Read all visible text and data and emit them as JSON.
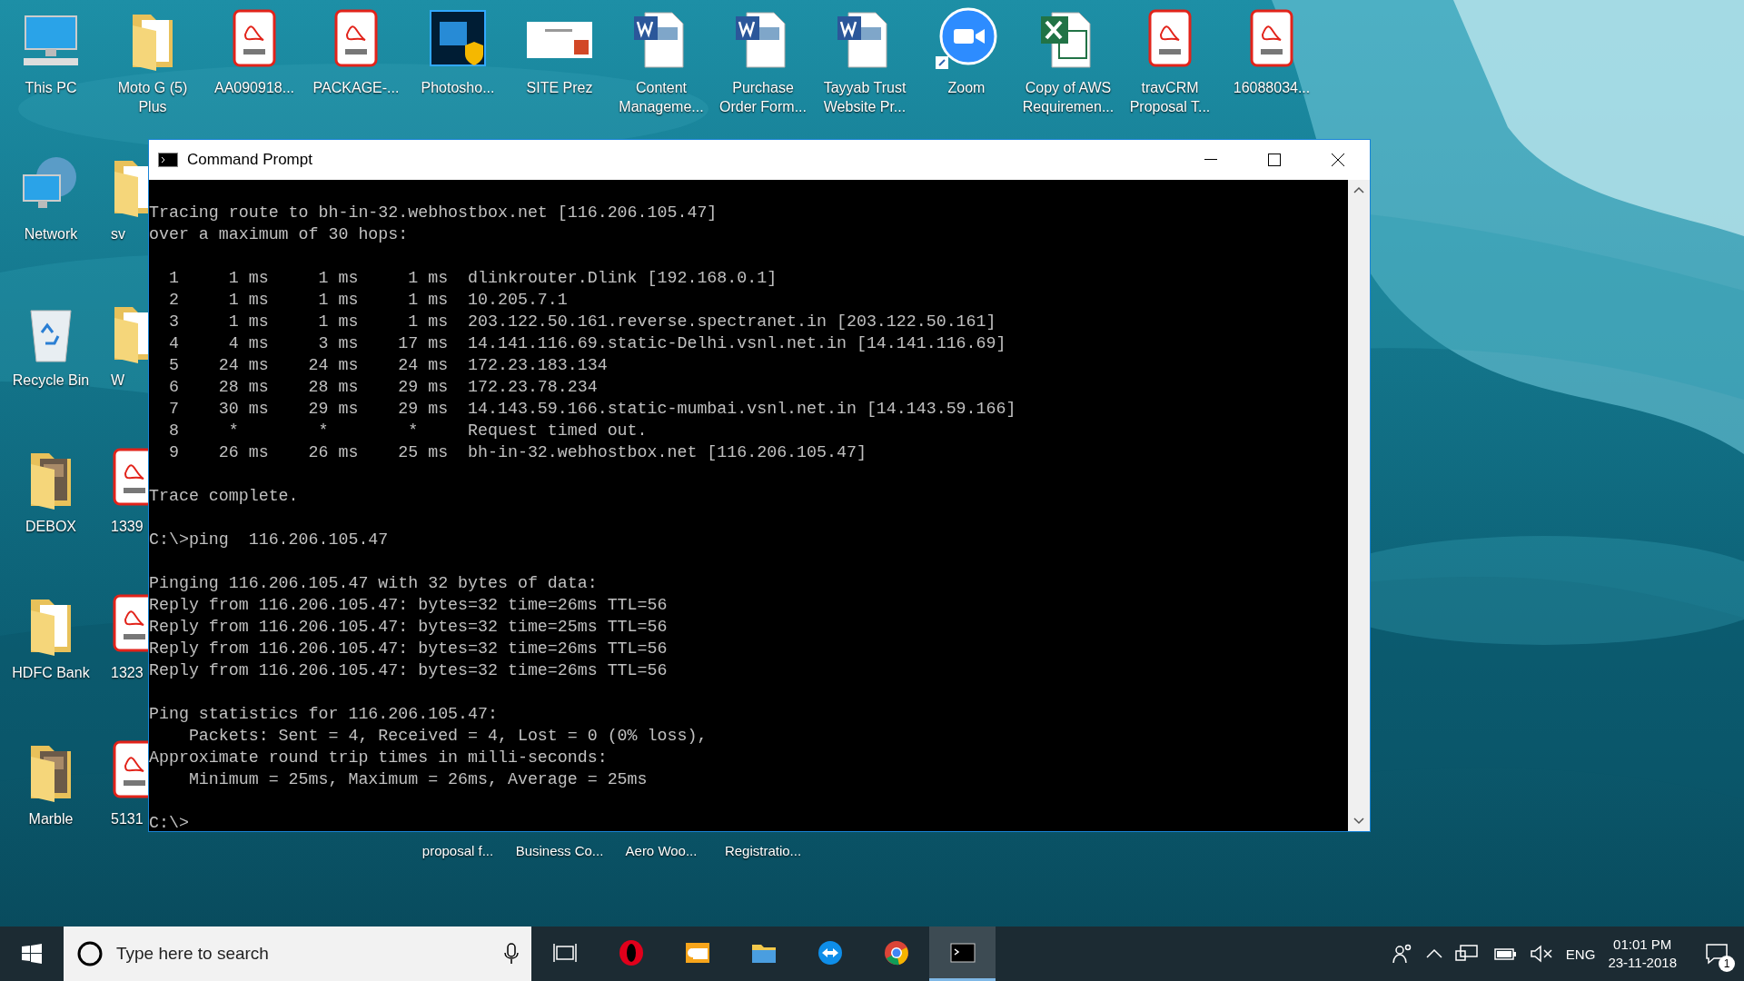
{
  "desktop": {
    "top_row": [
      {
        "label": "This PC",
        "kind": "pc"
      },
      {
        "label": "Moto G (5) Plus",
        "kind": "folder"
      },
      {
        "label": "AA090918...",
        "kind": "pdf"
      },
      {
        "label": "PACKAGE-...",
        "kind": "pdf"
      },
      {
        "label": "Photosho...",
        "kind": "photoshop"
      },
      {
        "label": "SITE Prez",
        "kind": "slides"
      },
      {
        "label": "Content Manageme...",
        "kind": "word"
      },
      {
        "label": "Purchase Order Form...",
        "kind": "word"
      },
      {
        "label": "Tayyab Trust Website Pr...",
        "kind": "word"
      },
      {
        "label": "Zoom",
        "kind": "zoom"
      },
      {
        "label": "Copy of AWS Requiremen...",
        "kind": "excel"
      },
      {
        "label": "travCRM Proposal T...",
        "kind": "pdf"
      },
      {
        "label": "16088034...",
        "kind": "pdf"
      }
    ],
    "first_column": [
      {
        "label": "Network",
        "kind": "network"
      },
      {
        "label": "Recycle Bin",
        "kind": "recycle"
      },
      {
        "label": "DEBOX",
        "kind": "photofolder"
      },
      {
        "label": "HDFC Bank",
        "kind": "folder"
      },
      {
        "label": "Marble",
        "kind": "photofolder"
      }
    ],
    "second_column": [
      {
        "label": "sv",
        "kind": "folder"
      },
      {
        "label": "W",
        "kind": "folder"
      },
      {
        "label": "1339",
        "kind": "pdf"
      },
      {
        "label": "1323",
        "kind": "pdf"
      },
      {
        "label": "5131",
        "kind": "pdf"
      }
    ],
    "bottom_row": [
      "proposal f...",
      "Business Co...",
      "Aero Woo...",
      "Registratio..."
    ]
  },
  "window": {
    "title": "Command Prompt",
    "lines": [
      {
        "text": "Tracing route to bh-in-32.webhostbox.net [116.206.105.47]"
      },
      {
        "text": "over a maximum of 30 hops:"
      },
      {
        "text": "  1     1 ms     1 ms     1 ms  dlinkrouter.Dlink [192.168.0.1]",
        "blank_before": true
      },
      {
        "text": "  2     1 ms     1 ms     1 ms  10.205.7.1"
      },
      {
        "text": "  3     1 ms     1 ms     1 ms  203.122.50.161.reverse.spectranet.in [203.122.50.161]"
      },
      {
        "text": "  4     4 ms     3 ms    17 ms  14.141.116.69.static-Delhi.vsnl.net.in [14.141.116.69]"
      },
      {
        "text": "  5    24 ms    24 ms    24 ms  172.23.183.134"
      },
      {
        "text": "  6    28 ms    28 ms    29 ms  172.23.78.234"
      },
      {
        "text": "  7    30 ms    29 ms    29 ms  14.143.59.166.static-mumbai.vsnl.net.in [14.143.59.166]"
      },
      {
        "text": "  8     *        *        *     Request timed out."
      },
      {
        "text": "  9    26 ms    26 ms    25 ms  bh-in-32.webhostbox.net [116.206.105.47]"
      },
      {
        "text": "Trace complete.",
        "blank_before": true
      },
      {
        "text": "C:\\>ping  116.206.105.47",
        "blank_before": true
      },
      {
        "text": "Pinging 116.206.105.47 with 32 bytes of data:",
        "blank_before": true
      },
      {
        "text": "Reply from 116.206.105.47: bytes=32 time=26ms TTL=56"
      },
      {
        "text": "Reply from 116.206.105.47: bytes=32 time=25ms TTL=56"
      },
      {
        "text": "Reply from 116.206.105.47: bytes=32 time=26ms TTL=56"
      },
      {
        "text": "Reply from 116.206.105.47: bytes=32 time=26ms TTL=56"
      },
      {
        "text": "Ping statistics for 116.206.105.47:",
        "blank_before": true
      },
      {
        "text": "    Packets: Sent = 4, Received = 4, Lost = 0 (0% loss),"
      },
      {
        "text": "Approximate round trip times in milli-seconds:"
      },
      {
        "text": "    Minimum = 25ms, Maximum = 26ms, Average = 25ms"
      },
      {
        "text": "C:\\>",
        "blank_before": true
      }
    ]
  },
  "taskbar": {
    "search": {
      "placeholder": "Type here to search"
    },
    "apps": [
      {
        "kind": "opera",
        "selected": false
      },
      {
        "kind": "mail",
        "selected": false
      },
      {
        "kind": "explorer",
        "selected": false
      },
      {
        "kind": "teamviewer",
        "selected": false
      },
      {
        "kind": "chrome",
        "selected": false
      },
      {
        "kind": "console",
        "selected": true
      }
    ],
    "language": "ENG",
    "time": "01:01 PM",
    "date": "23-11-2018",
    "notifications": "1"
  }
}
